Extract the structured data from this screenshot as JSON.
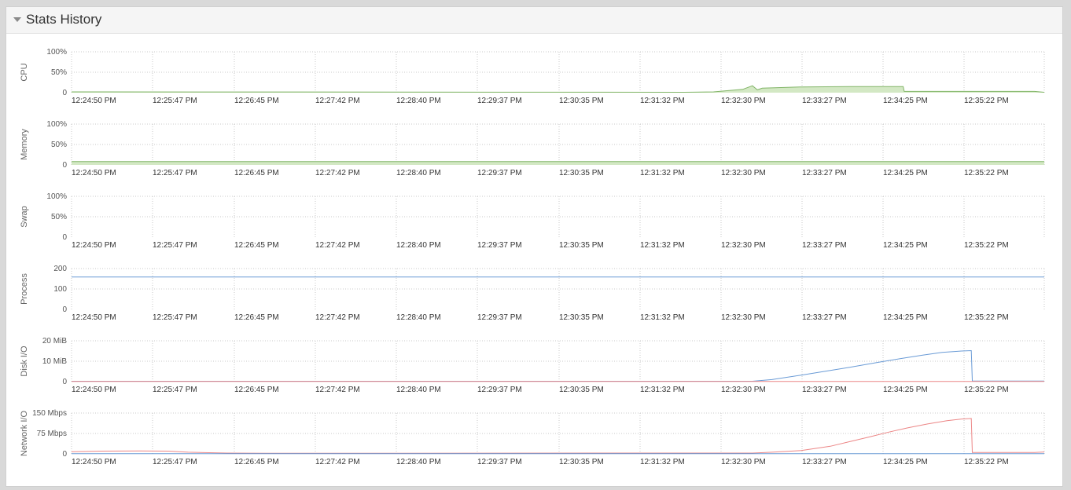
{
  "panel": {
    "title": "Stats History"
  },
  "colors": {
    "cpu_fill": "#d3e8c4",
    "cpu_line": "#82b568",
    "blue": "#6a9bd6",
    "red": "#ec8686",
    "grid": "#c8c8c8",
    "label": "#555555"
  },
  "chart_data": [
    {
      "type": "area",
      "ylabel": "CPU",
      "x": [
        "12:24:50 PM",
        "12:25:47 PM",
        "12:26:45 PM",
        "12:27:42 PM",
        "12:28:40 PM",
        "12:29:37 PM",
        "12:30:35 PM",
        "12:31:32 PM",
        "12:32:30 PM",
        "12:33:27 PM",
        "12:34:25 PM",
        "12:35:22 PM"
      ],
      "yticks": [
        "100%",
        "50%",
        "0"
      ],
      "ylim": [
        0,
        100
      ],
      "series": [
        {
          "style": "green-area",
          "points": [
            [
              0,
              2
            ],
            [
              0.63,
              1
            ],
            [
              0.66,
              2
            ],
            [
              0.69,
              8
            ],
            [
              0.7,
              17
            ],
            [
              0.705,
              7
            ],
            [
              0.71,
              11
            ],
            [
              0.75,
              14
            ],
            [
              0.8,
              15
            ],
            [
              0.855,
              15
            ],
            [
              0.856,
              3
            ],
            [
              0.99,
              3
            ],
            [
              1,
              1
            ]
          ]
        }
      ]
    },
    {
      "type": "area",
      "ylabel": "Memory",
      "x": [
        "12:24:50 PM",
        "12:25:47 PM",
        "12:26:45 PM",
        "12:27:42 PM",
        "12:28:40 PM",
        "12:29:37 PM",
        "12:30:35 PM",
        "12:31:32 PM",
        "12:32:30 PM",
        "12:33:27 PM",
        "12:34:25 PM",
        "12:35:22 PM"
      ],
      "yticks": [
        "100%",
        "50%",
        "0"
      ],
      "ylim": [
        0,
        100
      ],
      "series": [
        {
          "style": "green-area",
          "points": [
            [
              0,
              8
            ],
            [
              1,
              8
            ]
          ]
        }
      ]
    },
    {
      "type": "line",
      "ylabel": "Swap",
      "x": [
        "12:24:50 PM",
        "12:25:47 PM",
        "12:26:45 PM",
        "12:27:42 PM",
        "12:28:40 PM",
        "12:29:37 PM",
        "12:30:35 PM",
        "12:31:32 PM",
        "12:32:30 PM",
        "12:33:27 PM",
        "12:34:25 PM",
        "12:35:22 PM"
      ],
      "yticks": [
        "100%",
        "50%",
        "0"
      ],
      "ylim": [
        0,
        100
      ],
      "series": []
    },
    {
      "type": "line",
      "ylabel": "Process",
      "x": [
        "12:24:50 PM",
        "12:25:47 PM",
        "12:26:45 PM",
        "12:27:42 PM",
        "12:28:40 PM",
        "12:29:37 PM",
        "12:30:35 PM",
        "12:31:32 PM",
        "12:32:30 PM",
        "12:33:27 PM",
        "12:34:25 PM",
        "12:35:22 PM"
      ],
      "yticks": [
        "200",
        "100",
        "0"
      ],
      "ylim": [
        0,
        200
      ],
      "series": [
        {
          "style": "blue",
          "points": [
            [
              0,
              159
            ],
            [
              1,
              159
            ]
          ]
        }
      ]
    },
    {
      "type": "line",
      "ylabel": "Disk I/O",
      "x": [
        "12:24:50 PM",
        "12:25:47 PM",
        "12:26:45 PM",
        "12:27:42 PM",
        "12:28:40 PM",
        "12:29:37 PM",
        "12:30:35 PM",
        "12:31:32 PM",
        "12:32:30 PM",
        "12:33:27 PM",
        "12:34:25 PM",
        "12:35:22 PM"
      ],
      "yticks": [
        "20 MiB",
        "10 MiB",
        "0"
      ],
      "ylim": [
        0,
        20
      ],
      "series": [
        {
          "style": "blue",
          "points": [
            [
              0,
              0.2
            ],
            [
              0.7,
              0.2
            ],
            [
              0.72,
              1
            ],
            [
              0.75,
              3.2
            ],
            [
              0.78,
              5.5
            ],
            [
              0.8,
              7
            ],
            [
              0.83,
              9.5
            ],
            [
              0.855,
              11.5
            ],
            [
              0.875,
              13
            ],
            [
              0.895,
              14.3
            ],
            [
              0.915,
              15
            ],
            [
              0.925,
              15.2
            ],
            [
              0.926,
              0.3
            ],
            [
              1,
              0.3
            ]
          ]
        },
        {
          "style": "red",
          "points": [
            [
              0,
              0.1
            ],
            [
              1,
              0.1
            ]
          ]
        }
      ]
    },
    {
      "type": "line",
      "ylabel": "Network I/O",
      "x": [
        "12:24:50 PM",
        "12:25:47 PM",
        "12:26:45 PM",
        "12:27:42 PM",
        "12:28:40 PM",
        "12:29:37 PM",
        "12:30:35 PM",
        "12:31:32 PM",
        "12:32:30 PM",
        "12:33:27 PM",
        "12:34:25 PM",
        "12:35:22 PM"
      ],
      "yticks": [
        "150 Mbps",
        "75 Mbps",
        "0"
      ],
      "ylim": [
        0,
        150
      ],
      "series": [
        {
          "style": "red",
          "points": [
            [
              0,
              8
            ],
            [
              0.03,
              10
            ],
            [
              0.07,
              11
            ],
            [
              0.1,
              10
            ],
            [
              0.12,
              6
            ],
            [
              0.16,
              3
            ],
            [
              0.2,
              2
            ],
            [
              0.6,
              3
            ],
            [
              0.7,
              3
            ],
            [
              0.72,
              6
            ],
            [
              0.75,
              12
            ],
            [
              0.78,
              28
            ],
            [
              0.8,
              45
            ],
            [
              0.82,
              62
            ],
            [
              0.84,
              80
            ],
            [
              0.86,
              96
            ],
            [
              0.88,
              110
            ],
            [
              0.9,
              122
            ],
            [
              0.915,
              128
            ],
            [
              0.925,
              130
            ],
            [
              0.926,
              5
            ],
            [
              0.99,
              5
            ],
            [
              1,
              7
            ]
          ]
        },
        {
          "style": "blue",
          "points": [
            [
              0,
              1
            ],
            [
              1,
              1
            ]
          ]
        }
      ]
    }
  ]
}
